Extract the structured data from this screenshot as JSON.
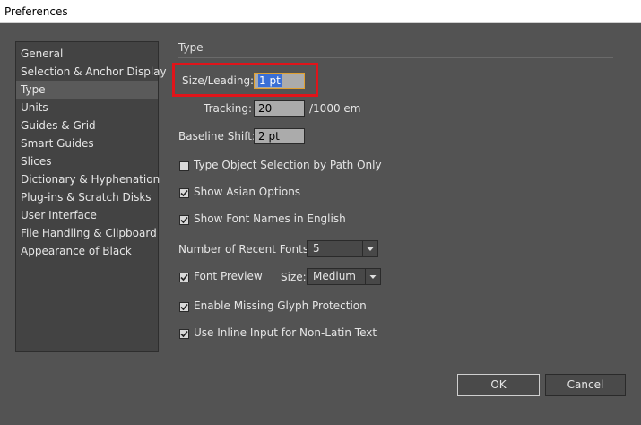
{
  "window": {
    "title": "Preferences"
  },
  "sidebar": {
    "items": [
      {
        "label": "General"
      },
      {
        "label": "Selection & Anchor Display"
      },
      {
        "label": "Type"
      },
      {
        "label": "Units"
      },
      {
        "label": "Guides & Grid"
      },
      {
        "label": "Smart Guides"
      },
      {
        "label": "Slices"
      },
      {
        "label": "Dictionary & Hyphenation"
      },
      {
        "label": "Plug-ins & Scratch Disks"
      },
      {
        "label": "User Interface"
      },
      {
        "label": "File Handling & Clipboard"
      },
      {
        "label": "Appearance of Black"
      }
    ],
    "selected": "Type"
  },
  "panel": {
    "section_title": "Type",
    "size_leading": {
      "label": "Size/Leading:",
      "value": "1 pt"
    },
    "tracking": {
      "label": "Tracking:",
      "value": "20",
      "unit": "/1000 em"
    },
    "baseline_shift": {
      "label": "Baseline Shift:",
      "value": "2 pt"
    },
    "checkboxes": {
      "type_object_selection": {
        "label": "Type Object Selection by Path Only",
        "checked": false
      },
      "show_asian_options": {
        "label": "Show Asian Options",
        "checked": true
      },
      "show_font_names_english": {
        "label": "Show Font Names in English",
        "checked": true
      },
      "font_preview": {
        "label": "Font Preview",
        "checked": true
      },
      "missing_glyph": {
        "label": "Enable Missing Glyph Protection",
        "checked": true
      },
      "inline_input": {
        "label": "Use Inline Input for Non-Latin Text",
        "checked": true
      }
    },
    "recent_fonts": {
      "label": "Number of Recent Fonts:",
      "value": "5"
    },
    "preview_size": {
      "label": "Size:",
      "value": "Medium"
    }
  },
  "buttons": {
    "ok": "OK",
    "cancel": "Cancel"
  },
  "colors": {
    "background": "#535353",
    "sidebar": "#434343",
    "highlight_box": "#e0141a",
    "selection": "#3a6fd6"
  }
}
